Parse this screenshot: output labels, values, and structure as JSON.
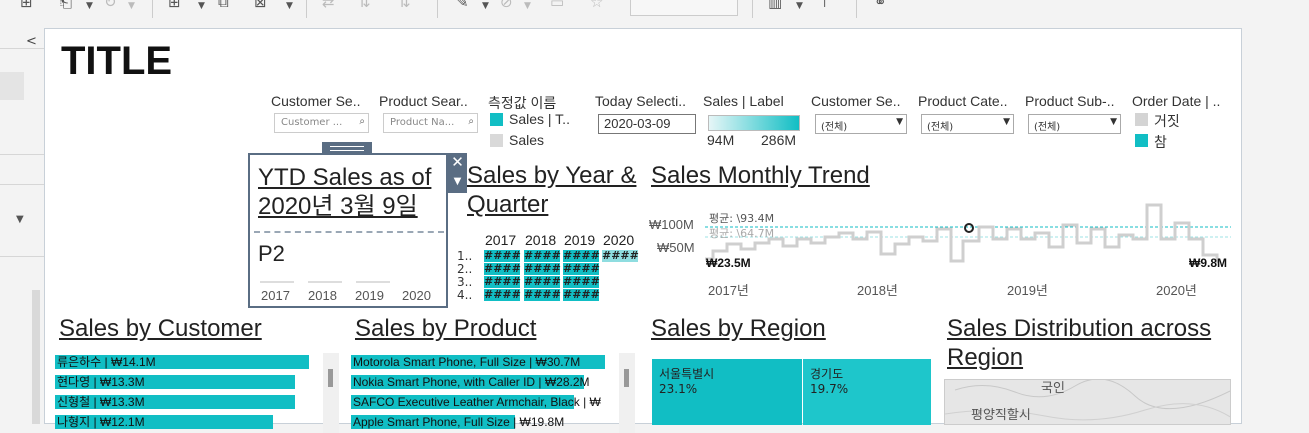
{
  "dashboard": {
    "title": "TITLE",
    "filters": [
      {
        "id": "customer-search",
        "label": "Customer Se..",
        "placeholder": "Customer ..."
      },
      {
        "id": "product-search",
        "label": "Product Sear..",
        "placeholder": "Product Na..."
      }
    ],
    "measure_legend": {
      "label": "측정값 이름",
      "items": [
        {
          "label": "Sales | T..",
          "color": "#11bec4"
        },
        {
          "label": "Sales",
          "color": "#d9d9d9"
        }
      ]
    },
    "today_selection": {
      "label": "Today Selecti..",
      "value": "2020-03-09"
    },
    "sales_label_legend": {
      "label": "Sales | Label",
      "min": "94M",
      "max": "286M"
    },
    "dropdowns": [
      {
        "id": "customer-segment",
        "label": "Customer Se..",
        "value": "(전체)"
      },
      {
        "id": "product-category",
        "label": "Product Cate..",
        "value": "(전체)"
      },
      {
        "id": "product-subcategory",
        "label": "Product Sub-..",
        "value": "(전체)"
      }
    ],
    "order_date_legend": {
      "label": "Order Date | ..",
      "items": [
        {
          "label": "거짓",
          "color": "#d4d4d4"
        },
        {
          "label": "참",
          "color": "#11bec4"
        }
      ]
    },
    "ytd": {
      "title": "YTD Sales as of 2020년 3월 9일",
      "value": "P2",
      "years": [
        "2017",
        "2018",
        "2019",
        "2020"
      ]
    },
    "year_quarter": {
      "title": "Sales by Year & Quarter",
      "years": [
        "2017",
        "2018",
        "2019",
        "2020"
      ],
      "quarters": [
        "1..",
        "2..",
        "3..",
        "4.."
      ],
      "cell_text": "####"
    },
    "monthly_trend": {
      "title": "Sales Monthly Trend",
      "y_ticks": [
        "₩100M",
        "₩50M"
      ],
      "avg_label": "평균: \\93.4M",
      "avg_label_2": "평균: \\64.7M",
      "start_label": "₩23.5M",
      "end_label": "₩9.8M",
      "x_ticks": [
        "2017년",
        "2018년",
        "2019년",
        "2020년"
      ]
    },
    "customer": {
      "title": "Sales by Customer",
      "rows": [
        {
          "label": "류은하수 | ₩14.1M",
          "value": 14.1
        },
        {
          "label": "현다영 | ₩13.3M",
          "value": 13.3
        },
        {
          "label": "신형철 | ₩13.3M",
          "value": 13.3
        },
        {
          "label": "나형지 | ₩12.1M",
          "value": 12.1
        }
      ]
    },
    "product": {
      "title": "Sales by Product",
      "rows": [
        {
          "label": "Motorola Smart Phone, Full Size | ₩30.7M",
          "value": 30.7
        },
        {
          "label": "Nokia Smart Phone, with Caller ID | ₩28.2M",
          "value": 28.2
        },
        {
          "label": "SAFCO Executive Leather Armchair, Black | ₩",
          "value": 27.0
        },
        {
          "label": "Apple Smart Phone, Full Size | ₩19.8M",
          "value": 19.8
        }
      ]
    },
    "region": {
      "title": "Sales by Region",
      "tiles": [
        {
          "name": "서울특별시",
          "pct": "23.1%",
          "share": 23.1,
          "color": "#11bec4"
        },
        {
          "name": "경기도",
          "pct": "19.7%",
          "share": 19.7,
          "color": "#1ec6cb"
        }
      ]
    },
    "distribution": {
      "title": "Sales Distribution across Region",
      "map_labels": [
        "국인",
        "평양직할시"
      ]
    }
  }
}
